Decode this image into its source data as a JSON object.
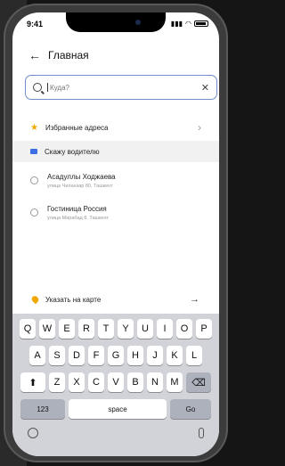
{
  "status": {
    "time": "9:41"
  },
  "header": {
    "title": "Главная"
  },
  "search": {
    "placeholder": "Куда?"
  },
  "favorites": {
    "label": "Избранные адреса"
  },
  "tell_driver": {
    "label": "Скажу водителю"
  },
  "recent": [
    {
      "name": "Асадуллы Ходжаева",
      "sub": "улица Чиланзар 80, Ташкент"
    },
    {
      "name": "Гостиница Россия",
      "sub": "улица Мирабад 8, Ташкент"
    }
  ],
  "map": {
    "label": "Указать на карте"
  },
  "keyboard": {
    "row1": [
      "Q",
      "W",
      "E",
      "R",
      "T",
      "Y",
      "U",
      "I",
      "O",
      "P"
    ],
    "row2": [
      "A",
      "S",
      "D",
      "F",
      "G",
      "H",
      "J",
      "K",
      "L"
    ],
    "row3": [
      "Z",
      "X",
      "C",
      "V",
      "B",
      "N",
      "M"
    ],
    "num_label": "123",
    "space_label": "space",
    "go_label": "Go"
  },
  "colors": {
    "accent": "#f0a800",
    "focus": "#6f8fc9",
    "chat": "#3c6fe3"
  }
}
